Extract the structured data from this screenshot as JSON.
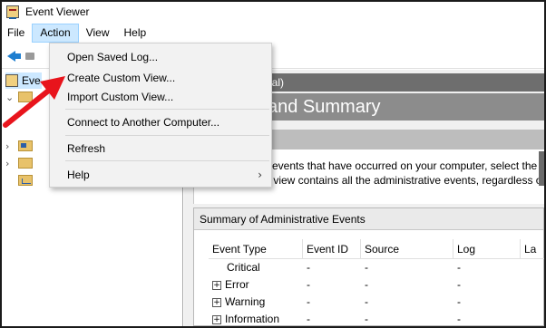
{
  "window": {
    "title": "Event Viewer"
  },
  "menubar": [
    {
      "label": "File"
    },
    {
      "label": "Action"
    },
    {
      "label": "View"
    },
    {
      "label": "Help"
    }
  ],
  "tree": {
    "root_label": "Eve",
    "items": [
      {
        "expand": "›",
        "icon": "folder-icon"
      },
      {
        "expand": "›",
        "icon": "folder-icon"
      },
      {
        "expand": "",
        "icon": "chart-folder-icon"
      }
    ]
  },
  "main": {
    "header": "ocal)",
    "title": "and Summary",
    "overview_line1": "w events that have occurred on your computer, select the",
    "overview_line2": "m view contains all the administrative events, regardless o",
    "summary_title": "Summary of Administrative Events",
    "columns": [
      "Event Type",
      "Event ID",
      "Source",
      "Log",
      "La"
    ],
    "rows": [
      {
        "type": "Critical",
        "expandable": false,
        "id": "-",
        "source": "-",
        "log": "-"
      },
      {
        "type": "Error",
        "expandable": true,
        "id": "-",
        "source": "-",
        "log": "-"
      },
      {
        "type": "Warning",
        "expandable": true,
        "id": "-",
        "source": "-",
        "log": "-"
      },
      {
        "type": "Information",
        "expandable": true,
        "id": "-",
        "source": "-",
        "log": "-"
      }
    ]
  },
  "action_menu": {
    "items": [
      {
        "label": "Open Saved Log..."
      },
      {
        "label": "Create Custom View..."
      },
      {
        "label": "Import Custom View..."
      },
      {
        "label": "Connect to Another Computer..."
      },
      {
        "label": "Refresh"
      },
      {
        "label": "Help",
        "submenu_arrow": "›"
      }
    ]
  },
  "colors": {
    "menu_active": "#cce8ff",
    "header_dark": "#6e6e6e",
    "annotation_arrow": "#e8141c"
  }
}
